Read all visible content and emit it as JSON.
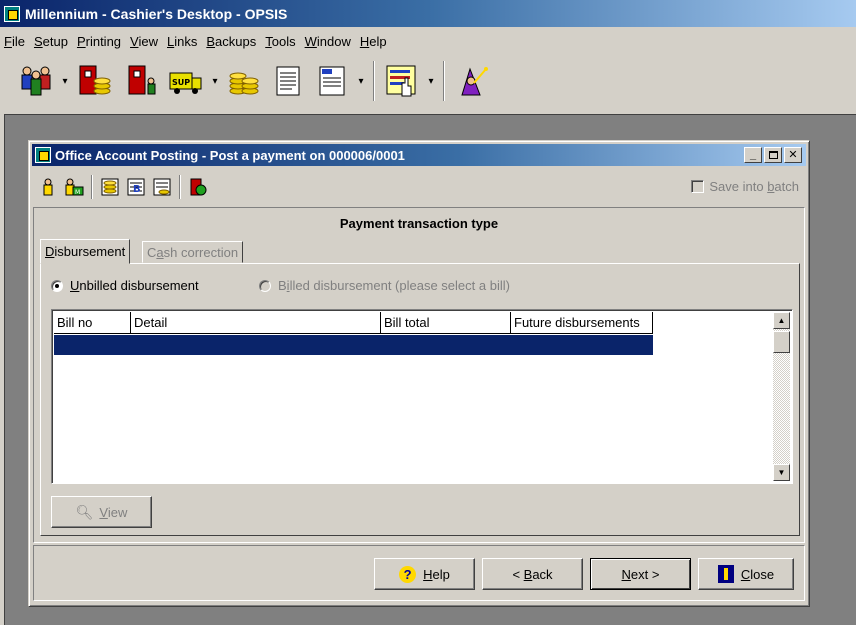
{
  "app": {
    "title": "Millennium - Cashier's Desktop - OPSIS",
    "menu": [
      {
        "pre": "",
        "key": "F",
        "post": "ile"
      },
      {
        "pre": "",
        "key": "S",
        "post": "etup"
      },
      {
        "pre": "",
        "key": "P",
        "post": "rinting"
      },
      {
        "pre": "",
        "key": "V",
        "post": "iew"
      },
      {
        "pre": "",
        "key": "L",
        "post": "inks"
      },
      {
        "pre": "",
        "key": "B",
        "post": "ackups"
      },
      {
        "pre": "",
        "key": "T",
        "post": "ools"
      },
      {
        "pre": "",
        "key": "W",
        "post": "indow"
      },
      {
        "pre": "",
        "key": "H",
        "post": "elp"
      }
    ]
  },
  "child": {
    "title": "Office Account Posting - Post a payment on 000006/0001",
    "save_batch": {
      "pre": "Save into ",
      "key": "b",
      "post": "atch"
    },
    "section_title": "Payment transaction type",
    "tabs": [
      {
        "pre": "",
        "key": "D",
        "post": "isbursement"
      },
      {
        "pre": "C",
        "key": "a",
        "post": "sh correction"
      }
    ],
    "radio_unbilled": {
      "pre": "",
      "key": "U",
      "post": "nbilled disbursement"
    },
    "radio_billed": {
      "pre": "B",
      "key": "i",
      "post": "lled disbursement (please select a bill)"
    },
    "columns": [
      "Bill no",
      "Detail",
      "Bill total",
      "Future disbursements"
    ],
    "view_button": {
      "pre": "",
      "key": "V",
      "post": "iew"
    },
    "buttons": {
      "help": {
        "pre": "",
        "key": "H",
        "post": "elp"
      },
      "back": {
        "pre": "< ",
        "key": "B",
        "post": "ack"
      },
      "next": {
        "pre": "",
        "key": "N",
        "post": "ext >"
      },
      "close": {
        "pre": "",
        "key": "C",
        "post": "lose"
      }
    }
  },
  "colors": {
    "title_active": "#0a246a",
    "selection": "#0a246a",
    "face": "#d4d0c8",
    "mdi_background": "#808080"
  },
  "icons": {
    "toolbar": [
      "people-icon",
      "cashier-coins-icon",
      "person-transfer-icon",
      "supplier-truck-icon",
      "coin-stack-icon",
      "scroll-document-icon",
      "form-document-icon",
      "hand-pointer-list-icon",
      "wizard-icon"
    ],
    "child_toolbar": [
      "person-icon",
      "matter-person-icon",
      "coins-ledger-icon",
      "bill-ledger-icon",
      "cashbook-icon",
      "posting-icon"
    ]
  }
}
